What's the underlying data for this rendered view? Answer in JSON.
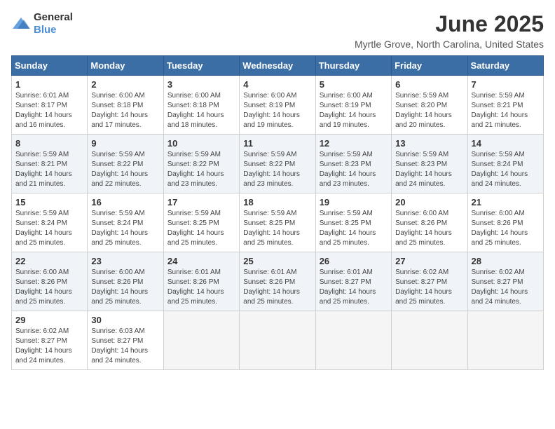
{
  "logo": {
    "general": "General",
    "blue": "Blue"
  },
  "title": "June 2025",
  "location": "Myrtle Grove, North Carolina, United States",
  "days_of_week": [
    "Sunday",
    "Monday",
    "Tuesday",
    "Wednesday",
    "Thursday",
    "Friday",
    "Saturday"
  ],
  "weeks": [
    [
      {
        "day": "1",
        "sunrise": "6:01 AM",
        "sunset": "8:17 PM",
        "daylight": "14 hours and 16 minutes."
      },
      {
        "day": "2",
        "sunrise": "6:00 AM",
        "sunset": "8:18 PM",
        "daylight": "14 hours and 17 minutes."
      },
      {
        "day": "3",
        "sunrise": "6:00 AM",
        "sunset": "8:18 PM",
        "daylight": "14 hours and 18 minutes."
      },
      {
        "day": "4",
        "sunrise": "6:00 AM",
        "sunset": "8:19 PM",
        "daylight": "14 hours and 19 minutes."
      },
      {
        "day": "5",
        "sunrise": "6:00 AM",
        "sunset": "8:19 PM",
        "daylight": "14 hours and 19 minutes."
      },
      {
        "day": "6",
        "sunrise": "5:59 AM",
        "sunset": "8:20 PM",
        "daylight": "14 hours and 20 minutes."
      },
      {
        "day": "7",
        "sunrise": "5:59 AM",
        "sunset": "8:21 PM",
        "daylight": "14 hours and 21 minutes."
      }
    ],
    [
      {
        "day": "8",
        "sunrise": "5:59 AM",
        "sunset": "8:21 PM",
        "daylight": "14 hours and 21 minutes."
      },
      {
        "day": "9",
        "sunrise": "5:59 AM",
        "sunset": "8:22 PM",
        "daylight": "14 hours and 22 minutes."
      },
      {
        "day": "10",
        "sunrise": "5:59 AM",
        "sunset": "8:22 PM",
        "daylight": "14 hours and 23 minutes."
      },
      {
        "day": "11",
        "sunrise": "5:59 AM",
        "sunset": "8:22 PM",
        "daylight": "14 hours and 23 minutes."
      },
      {
        "day": "12",
        "sunrise": "5:59 AM",
        "sunset": "8:23 PM",
        "daylight": "14 hours and 23 minutes."
      },
      {
        "day": "13",
        "sunrise": "5:59 AM",
        "sunset": "8:23 PM",
        "daylight": "14 hours and 24 minutes."
      },
      {
        "day": "14",
        "sunrise": "5:59 AM",
        "sunset": "8:24 PM",
        "daylight": "14 hours and 24 minutes."
      }
    ],
    [
      {
        "day": "15",
        "sunrise": "5:59 AM",
        "sunset": "8:24 PM",
        "daylight": "14 hours and 25 minutes."
      },
      {
        "day": "16",
        "sunrise": "5:59 AM",
        "sunset": "8:24 PM",
        "daylight": "14 hours and 25 minutes."
      },
      {
        "day": "17",
        "sunrise": "5:59 AM",
        "sunset": "8:25 PM",
        "daylight": "14 hours and 25 minutes."
      },
      {
        "day": "18",
        "sunrise": "5:59 AM",
        "sunset": "8:25 PM",
        "daylight": "14 hours and 25 minutes."
      },
      {
        "day": "19",
        "sunrise": "5:59 AM",
        "sunset": "8:25 PM",
        "daylight": "14 hours and 25 minutes."
      },
      {
        "day": "20",
        "sunrise": "6:00 AM",
        "sunset": "8:26 PM",
        "daylight": "14 hours and 25 minutes."
      },
      {
        "day": "21",
        "sunrise": "6:00 AM",
        "sunset": "8:26 PM",
        "daylight": "14 hours and 25 minutes."
      }
    ],
    [
      {
        "day": "22",
        "sunrise": "6:00 AM",
        "sunset": "8:26 PM",
        "daylight": "14 hours and 25 minutes."
      },
      {
        "day": "23",
        "sunrise": "6:00 AM",
        "sunset": "8:26 PM",
        "daylight": "14 hours and 25 minutes."
      },
      {
        "day": "24",
        "sunrise": "6:01 AM",
        "sunset": "8:26 PM",
        "daylight": "14 hours and 25 minutes."
      },
      {
        "day": "25",
        "sunrise": "6:01 AM",
        "sunset": "8:26 PM",
        "daylight": "14 hours and 25 minutes."
      },
      {
        "day": "26",
        "sunrise": "6:01 AM",
        "sunset": "8:27 PM",
        "daylight": "14 hours and 25 minutes."
      },
      {
        "day": "27",
        "sunrise": "6:02 AM",
        "sunset": "8:27 PM",
        "daylight": "14 hours and 25 minutes."
      },
      {
        "day": "28",
        "sunrise": "6:02 AM",
        "sunset": "8:27 PM",
        "daylight": "14 hours and 24 minutes."
      }
    ],
    [
      {
        "day": "29",
        "sunrise": "6:02 AM",
        "sunset": "8:27 PM",
        "daylight": "14 hours and 24 minutes."
      },
      {
        "day": "30",
        "sunrise": "6:03 AM",
        "sunset": "8:27 PM",
        "daylight": "14 hours and 24 minutes."
      },
      null,
      null,
      null,
      null,
      null
    ]
  ],
  "labels": {
    "sunrise": "Sunrise:",
    "sunset": "Sunset:",
    "daylight": "Daylight:"
  }
}
